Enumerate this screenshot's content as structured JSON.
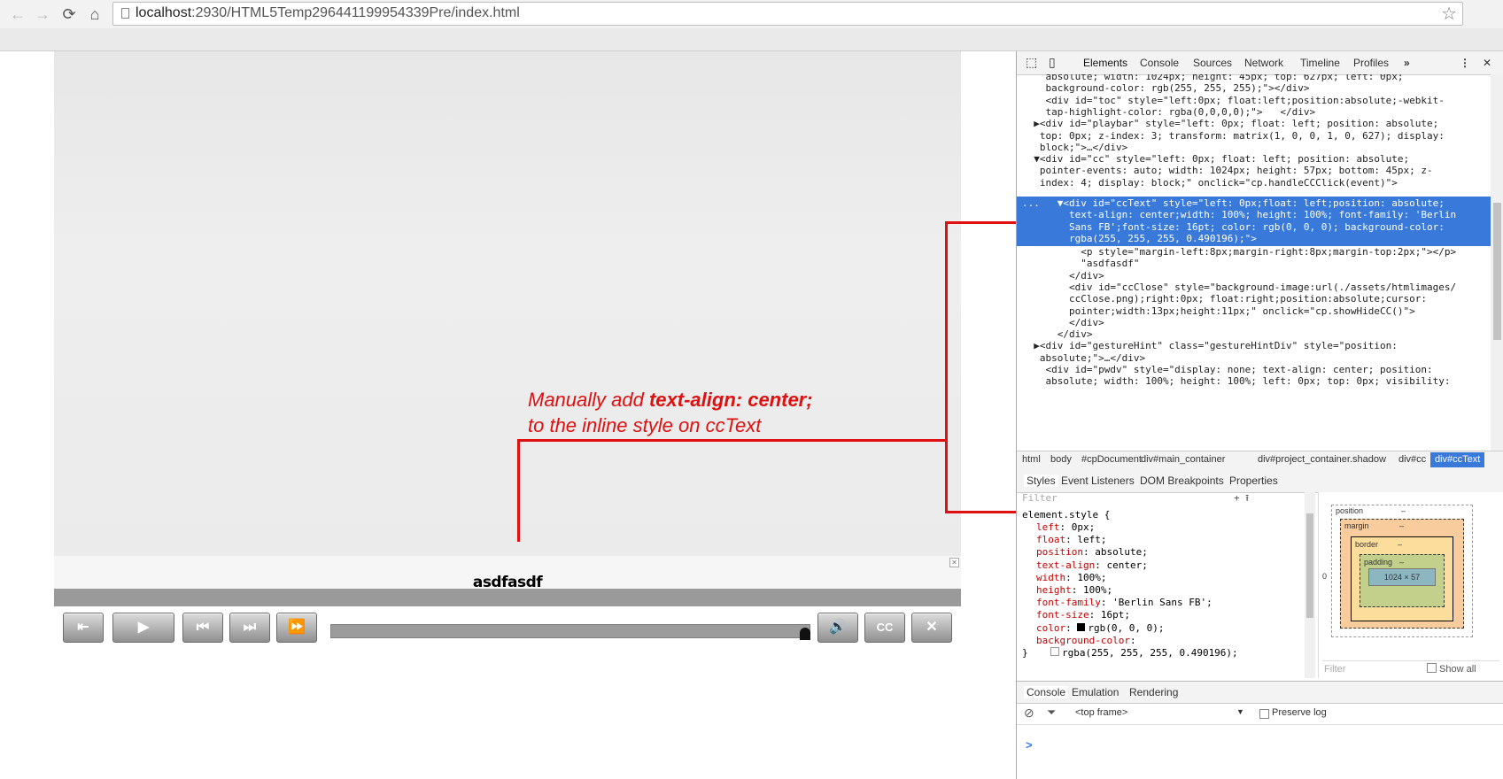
{
  "browser": {
    "url_host": "localhost",
    "url_rest": ":2930/HTML5Temp296441199954339Pre/index.html"
  },
  "stage": {
    "cc_text": "asdfasdf",
    "cc_button": "CC",
    "annotation_line1_prefix": "Manually add ",
    "annotation_line1_bold": "text-align: center;",
    "annotation_line2": "to the inline style on ccText"
  },
  "devtools": {
    "tabs": [
      "Elements",
      "Console",
      "Sources",
      "Network",
      "Timeline",
      "Profiles"
    ],
    "more": "»",
    "dom_lines": [
      "    absolute; width: 1024px; height: 45px; top: 627px; left: 0px;",
      "    background-color: rgb(255, 255, 255);\"></div>",
      "    <div id=\"toc\" style=\"left:0px; float:left;position:absolute;-webkit-",
      "    tap-highlight-color: rgba(0,0,0,0);\">   </div>",
      "  ▶<div id=\"playbar\" style=\"left: 0px; float: left; position: absolute;",
      "   top: 0px; z-index: 3; transform: matrix(1, 0, 0, 1, 0, 627); display:",
      "   block;\">…</div>",
      "  ▼<div id=\"cc\" style=\"left: 0px; float: left; position: absolute;",
      "   pointer-events: auto; width: 1024px; height: 57px; bottom: 45px; z-",
      "   index: 4; display: block;\" onclick=\"cp.handleCCClick(event)\">"
    ],
    "selected_lines": [
      "...   ▼<div id=\"ccText\" style=\"left: 0px;float: left;position: absolute;",
      "        text-align: center;width: 100%; height: 100%; font-family: 'Berlin",
      "        Sans FB';font-size: 16pt; color: rgb(0, 0, 0); background-color:",
      "        rgba(255, 255, 255, 0.490196);\">"
    ],
    "dom_lines_after": [
      "          <p style=\"margin-left:8px;margin-right:8px;margin-top:2px;\"></p>",
      "          \"asdfasdf\"",
      "        </div>",
      "        <div id=\"ccClose\" style=\"background-image:url(./assets/htmlimages/",
      "        ccClose.png);right:0px; float:right;position:absolute;cursor:",
      "        pointer;width:13px;height:11px;\" onclick=\"cp.showHideCC()\">",
      "        </div>",
      "      </div>",
      "  ▶<div id=\"gestureHint\" class=\"gestureHintDiv\" style=\"position:",
      "   absolute;\">…</div>",
      "    <div id=\"pwdv\" style=\"display: none; text-align: center; position:",
      "    absolute; width: 100%; height: 100%; left: 0px; top: 0px; visibility:"
    ],
    "breadcrumbs": [
      "html",
      "body",
      "#cpDocument",
      "div#main_container",
      "div#project_container.shadow",
      "div#cc",
      "div#ccText"
    ],
    "side_tabs": [
      "Styles",
      "Event Listeners",
      "DOM Breakpoints",
      "Properties"
    ],
    "filter_placeholder": "Filter",
    "style_selector": "element.style {",
    "style_rules": [
      {
        "prop": "left",
        "value": "0px;"
      },
      {
        "prop": "float",
        "value": "left;"
      },
      {
        "prop": "position",
        "value": "absolute;"
      },
      {
        "prop": "text-align",
        "value": "center;"
      },
      {
        "prop": "width",
        "value": "100%;"
      },
      {
        "prop": "height",
        "value": "100%;"
      },
      {
        "prop": "font-family",
        "value": "'Berlin Sans FB';"
      },
      {
        "prop": "font-size",
        "value": "16pt;"
      },
      {
        "prop": "color",
        "value": "rgb(0, 0, 0);"
      },
      {
        "prop": "background-color",
        "value": ""
      }
    ],
    "bg_value": "rgba(255, 255, 255, 0.490196);",
    "style_close": "}",
    "box_model": {
      "position": "position",
      "margin": "margin",
      "border": "border",
      "padding": "padding",
      "content": "1024 × 57",
      "dash": "–",
      "zero": "0"
    },
    "box_filter": "Filter",
    "show_all": "Show all",
    "console_tabs": [
      "Console",
      "Emulation",
      "Rendering"
    ],
    "frame_select": "<top frame>",
    "preserve_log": "Preserve log",
    "prompt": ">"
  }
}
